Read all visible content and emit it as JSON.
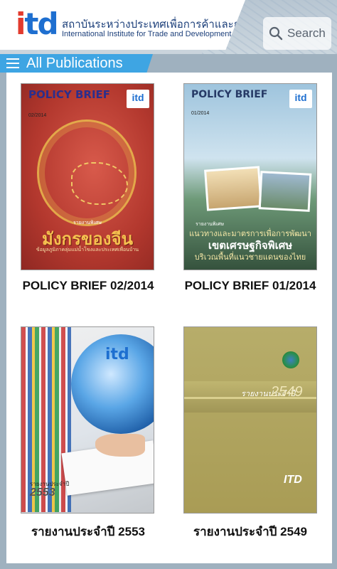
{
  "header": {
    "logo_text": "itd",
    "org_name_thai": "สถาบันระหว่างประเทศเพื่อการค้าและการพัฒนา",
    "org_name_english": "International Institute for Trade and Development",
    "search_label": "Search"
  },
  "section": {
    "title": "All Publications"
  },
  "publications": [
    {
      "title": "POLICY BRIEF 02/2014",
      "cover": {
        "series_title": "POLICY BRIEF",
        "issue": "02/2014",
        "logo": "itd",
        "headline_small": "รายงานพิเศษ",
        "headline": "มังกรของจีน",
        "subtitle": "ข้อมูลภูมิภาคลุ่มแม่น้ำโขงและประเทศเพื่อนบ้าน"
      }
    },
    {
      "title": "POLICY BRIEF 01/2014",
      "cover": {
        "series_title": "POLICY BRIEF",
        "issue": "01/2014",
        "logo": "itd",
        "headline_small": "รายงานพิเศษ",
        "line1": "แนวทางและมาตรการเพื่อการพัฒนา",
        "line2": "เขตเศรษฐกิจพิเศษ",
        "line3": "บริเวณพื้นที่แนวชายแดนของไทย"
      }
    },
    {
      "title": "รายงานประจำปี 2553",
      "cover": {
        "logo": "itd",
        "label": "รายงานประจำปี",
        "year": "2553"
      }
    },
    {
      "title": "รายงานประจำปี 2549",
      "cover": {
        "label": "รายงานประจำปี",
        "year": "2549",
        "logo": "ITD"
      }
    }
  ]
}
